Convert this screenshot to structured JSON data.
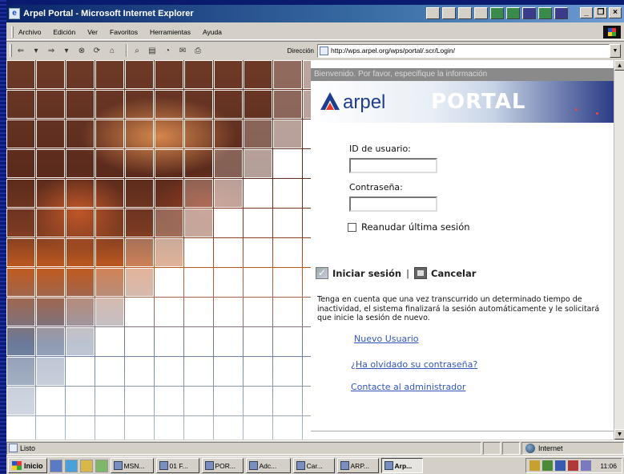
{
  "window": {
    "title": "Arpel Portal - Microsoft Internet Explorer",
    "controls": {
      "minimize": "_",
      "maximize": "❐",
      "close": "×"
    }
  },
  "menubar": {
    "items": [
      "Archivo",
      "Edición",
      "Ver",
      "Favoritos",
      "Herramientas",
      "Ayuda"
    ]
  },
  "toolbar": {
    "icons": [
      "back-icon",
      "forward-icon",
      "stop-icon",
      "refresh-icon",
      "home-icon",
      "search-icon",
      "favorites-icon",
      "history-icon",
      "mail-icon",
      "print-icon",
      "edit-icon"
    ],
    "address_label": "Dirección",
    "address_value": "http://wps.arpel.org/wps/portal/.scr/Login/"
  },
  "page": {
    "welcome": "Bienvenido. Por favor, especifique la información",
    "brand": "arpel",
    "portal": "PORTAL",
    "user_id_label": "ID de usuario:",
    "user_id_value": "",
    "password_label": "Contraseña:",
    "password_value": "",
    "resume_label": "Reanudar última sesión",
    "login_label": "Iniciar sesión",
    "separator": "|",
    "cancel_label": "Cancelar",
    "note": "Tenga en cuenta que una vez transcurrido un determinado tiempo de inactividad, el sistema finalizará la sesión automáticamente y le solicitará que inicie la sesión de nuevo.",
    "links": {
      "new_user": "Nuevo Usuario",
      "forgot_password": "¿Ha olvidado su contraseña?",
      "contact_admin": "Contacte al administrador"
    }
  },
  "statusbar": {
    "text": "Listo",
    "zone": "Internet"
  },
  "taskbar": {
    "start": "Inicio",
    "tasks": [
      "MSN...",
      "01 F...",
      "POR...",
      "Adc...",
      "Car...",
      "ARP...",
      "Arp..."
    ],
    "active_task": "Arp...",
    "clock": "11:06"
  },
  "colors": {
    "titlebar": "#0a246a",
    "link": "#3355bb",
    "brand": "#1f3d8f"
  }
}
